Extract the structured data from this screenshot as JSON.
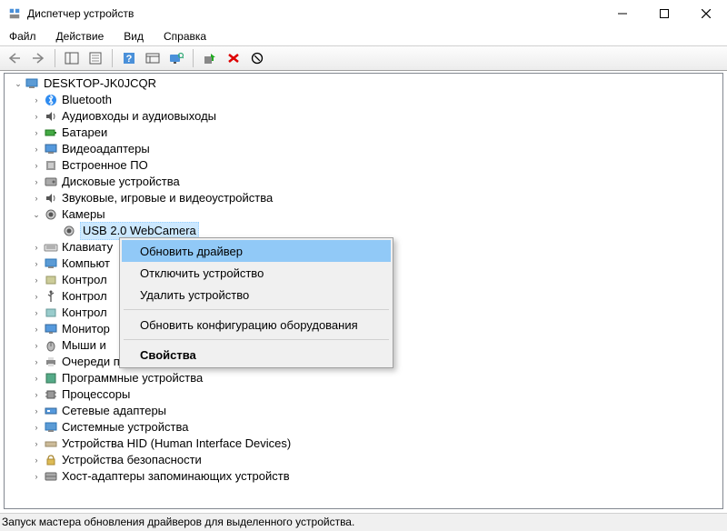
{
  "window": {
    "title": "Диспетчер устройств"
  },
  "menu": {
    "file": "Файл",
    "action": "Действие",
    "view": "Вид",
    "help": "Справка"
  },
  "root": {
    "name": "DESKTOP-JK0JCQR"
  },
  "categories": {
    "bluetooth": "Bluetooth",
    "audio": "Аудиовходы и аудиовыходы",
    "batteries": "Батареи",
    "display": "Видеоадаптеры",
    "firmware": "Встроенное ПО",
    "disk": "Дисковые устройства",
    "sound": "Звуковые, игровые и видеоустройства",
    "cameras": "Камеры",
    "camera_device": "USB 2.0 WebCamera",
    "keyboards": "Клавиату",
    "computer": "Компьют",
    "ide": "Контрол",
    "usb_ctrl": "Контрол",
    "storage_ctrl": "Контрол",
    "monitors": "Монитор",
    "mice": "Мыши и",
    "print_queues": "Очереди печати",
    "software": "Программные устройства",
    "processors": "Процессоры",
    "network": "Сетевые адаптеры",
    "system": "Системные устройства",
    "hid": "Устройства HID (Human Interface Devices)",
    "security": "Устройства безопасности",
    "host": "Хост-адаптеры запоминающих устройств"
  },
  "context_menu": {
    "update": "Обновить драйвер",
    "disable": "Отключить устройство",
    "uninstall": "Удалить устройство",
    "scan": "Обновить конфигурацию оборудования",
    "properties": "Свойства"
  },
  "statusbar": {
    "text": "Запуск мастера обновления драйверов для выделенного устройства."
  }
}
